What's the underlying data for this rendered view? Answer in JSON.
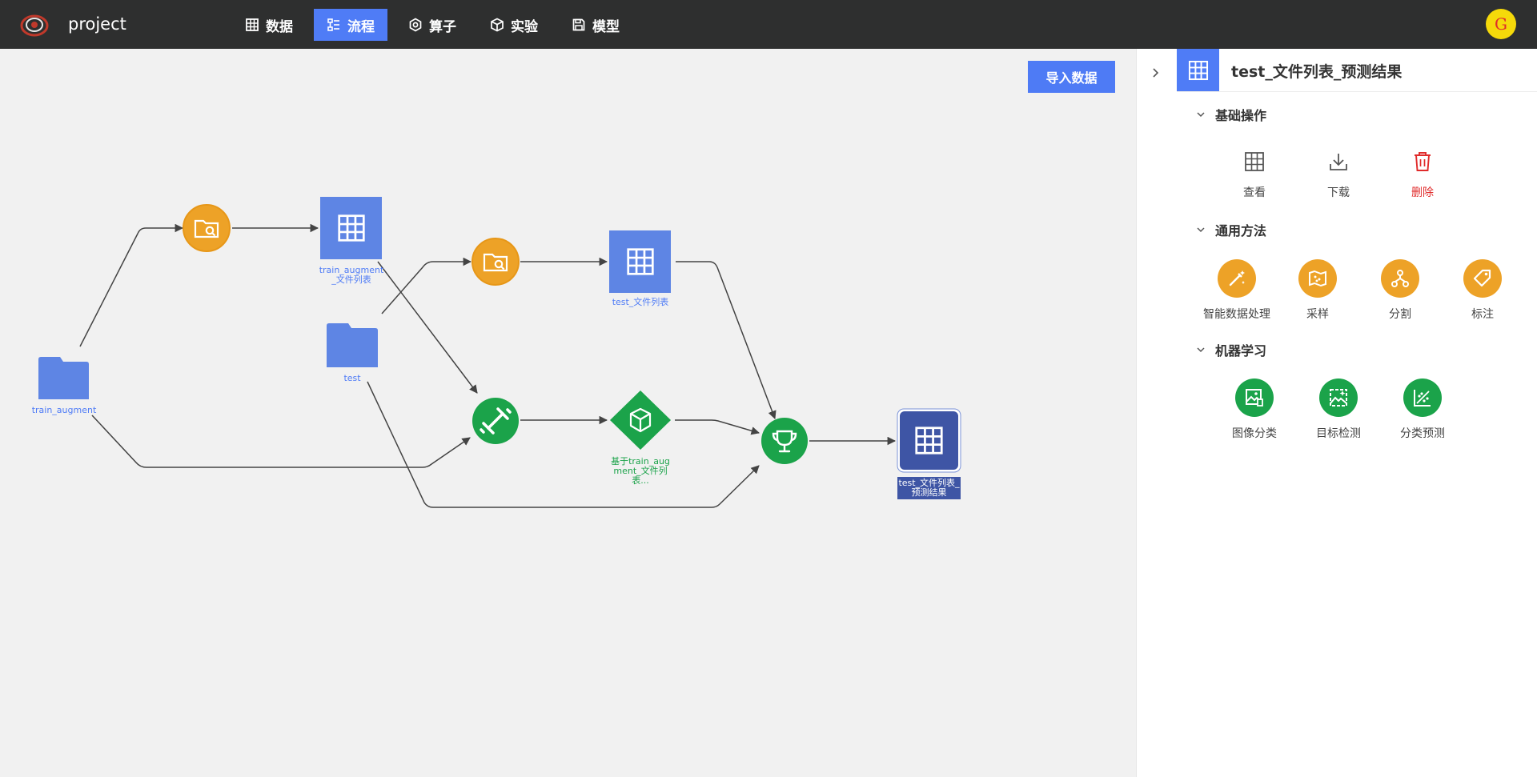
{
  "topbar": {
    "project_name": "project",
    "nav": [
      {
        "label": "数据",
        "icon": "table-icon"
      },
      {
        "label": "流程",
        "icon": "flow-icon",
        "active": true
      },
      {
        "label": "算子",
        "icon": "hexagon-icon"
      },
      {
        "label": "实验",
        "icon": "cube-icon"
      },
      {
        "label": "模型",
        "icon": "save-icon"
      }
    ],
    "avatar_letter": "G"
  },
  "canvas": {
    "import_button": "导入数据",
    "nodes": {
      "train_augment_folder": "train_augment",
      "train_augment_list": "train_augment_文件列表",
      "test_folder": "test",
      "test_list": "test_文件列表",
      "model": "基于train_augment_文件列表...",
      "result": "test_文件列表_预测结果"
    }
  },
  "panel": {
    "title": "test_文件列表_预测结果",
    "sections": [
      {
        "title": "基础操作",
        "items": [
          "查看",
          "下载",
          "删除"
        ]
      },
      {
        "title": "通用方法",
        "items": [
          "智能数据处理",
          "采样",
          "分割",
          "标注"
        ]
      },
      {
        "title": "机器学习",
        "items": [
          "图像分类",
          "目标检测",
          "分类预测"
        ]
      }
    ]
  },
  "colors": {
    "topbar": "#2e2f2f",
    "accent_blue": "#4f7cf6",
    "orange": "#eda227",
    "green": "#1ba34a",
    "selected_node": "#3e55a5",
    "danger": "#e02b2b"
  }
}
